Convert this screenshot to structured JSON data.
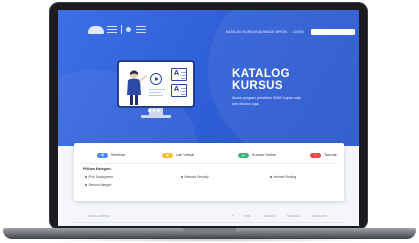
{
  "nav": {
    "links": [
      "KATALOG KURSUS",
      "ADVANCE WHOIS",
      "LOGIN"
    ],
    "search_placeholder": ""
  },
  "hero": {
    "title_line1": "KATALOG",
    "title_line2": "KURSUS",
    "subtitle": "Akses program pelatihan IDNIC kapan saja dan dimana saja."
  },
  "filter": {
    "chips": [
      {
        "label": "Webinar",
        "color": "#4a86f0"
      },
      {
        "label": "Lab Virtual",
        "color": "#f2c230"
      },
      {
        "label": "Kursus Online",
        "color": "#3cb878"
      },
      {
        "label": "Tutorial",
        "color": "#e8474b"
      }
    ],
    "category_title": "Pilihan Kategori:",
    "categories": [
      "IPv6 Deployment",
      "Network Security",
      "Internet Routing",
      "Semua Kategori"
    ]
  },
  "table": {
    "headers": [
      "JUDUL KURSUS",
      "T",
      "TIPE",
      "DURASI",
      "TANGGAL",
      "KATEGORI"
    ]
  },
  "colors": {
    "hero_blue": "#2f5fd6",
    "laptop_frame": "#1b1c1f"
  }
}
